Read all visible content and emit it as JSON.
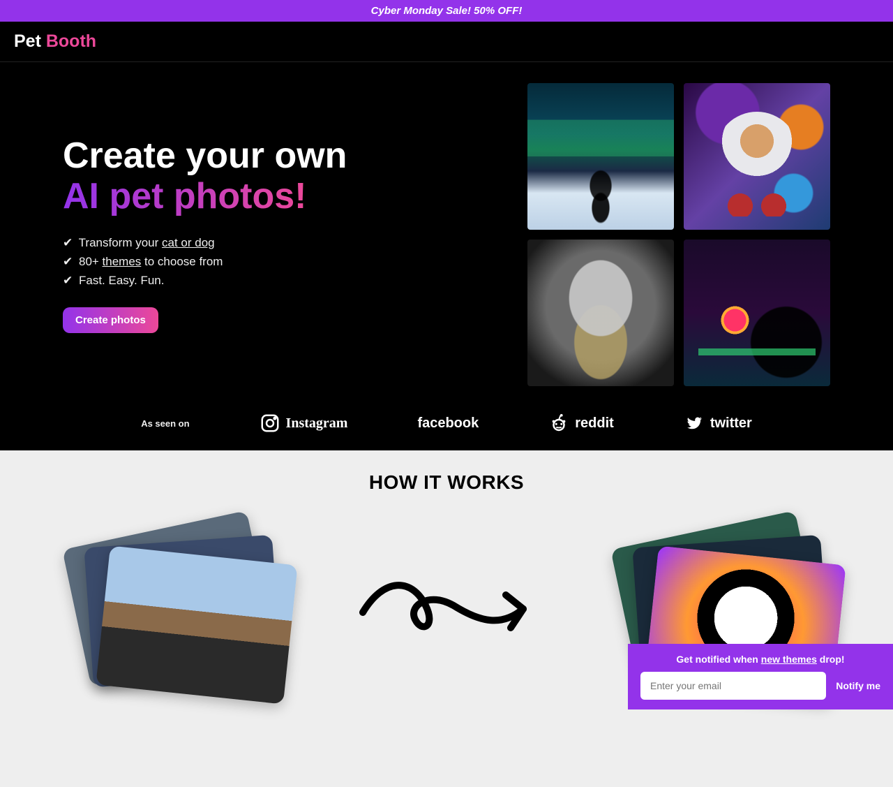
{
  "promo": "Cyber Monday Sale! 50% OFF!",
  "brand": {
    "a": "Pet ",
    "b": "Booth"
  },
  "hero": {
    "line1": "Create your own",
    "line2": "AI pet photos!",
    "f1_pre": "Transform your ",
    "f1_link": "cat or dog",
    "f2_pre": "80+ ",
    "f2_link": "themes",
    "f2_post": " to choose from",
    "f3": "Fast. Easy. Fun.",
    "cta": "Create photos"
  },
  "check": "✔",
  "as_seen": {
    "label": "As seen on",
    "instagram": "Instagram",
    "facebook": "facebook",
    "reddit": "reddit",
    "twitter": "twitter"
  },
  "how_title": "HOW IT WORKS",
  "notify": {
    "pre": "Get notified when ",
    "link": "new themes",
    "post": " drop!",
    "placeholder": "Enter your email",
    "button": "Notify me"
  }
}
